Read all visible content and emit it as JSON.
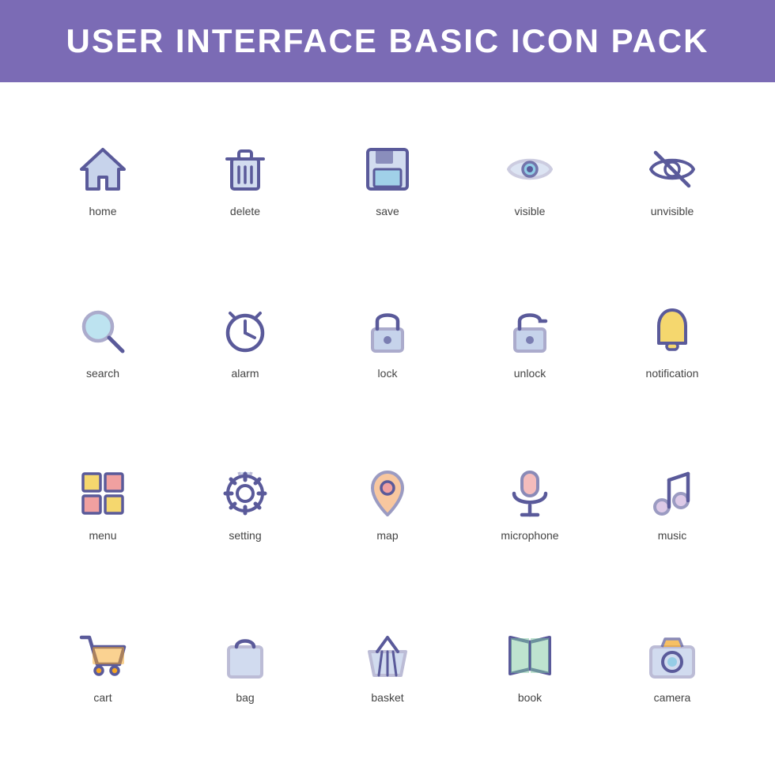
{
  "header": {
    "title": "USER INTERFACE BASIC ICON PACK"
  },
  "icons": [
    {
      "name": "home",
      "label": "home"
    },
    {
      "name": "delete",
      "label": "delete"
    },
    {
      "name": "save",
      "label": "save"
    },
    {
      "name": "visible",
      "label": "visible"
    },
    {
      "name": "unvisible",
      "label": "unvisible"
    },
    {
      "name": "search",
      "label": "search"
    },
    {
      "name": "alarm",
      "label": "alarm"
    },
    {
      "name": "lock",
      "label": "lock"
    },
    {
      "name": "unlock",
      "label": "unlock"
    },
    {
      "name": "notification",
      "label": "notification"
    },
    {
      "name": "menu",
      "label": "menu"
    },
    {
      "name": "setting",
      "label": "setting"
    },
    {
      "name": "map",
      "label": "map"
    },
    {
      "name": "microphone",
      "label": "microphone"
    },
    {
      "name": "music",
      "label": "music"
    },
    {
      "name": "cart",
      "label": "cart"
    },
    {
      "name": "bag",
      "label": "bag"
    },
    {
      "name": "basket",
      "label": "basket"
    },
    {
      "name": "book",
      "label": "book"
    },
    {
      "name": "camera",
      "label": "camera"
    }
  ]
}
